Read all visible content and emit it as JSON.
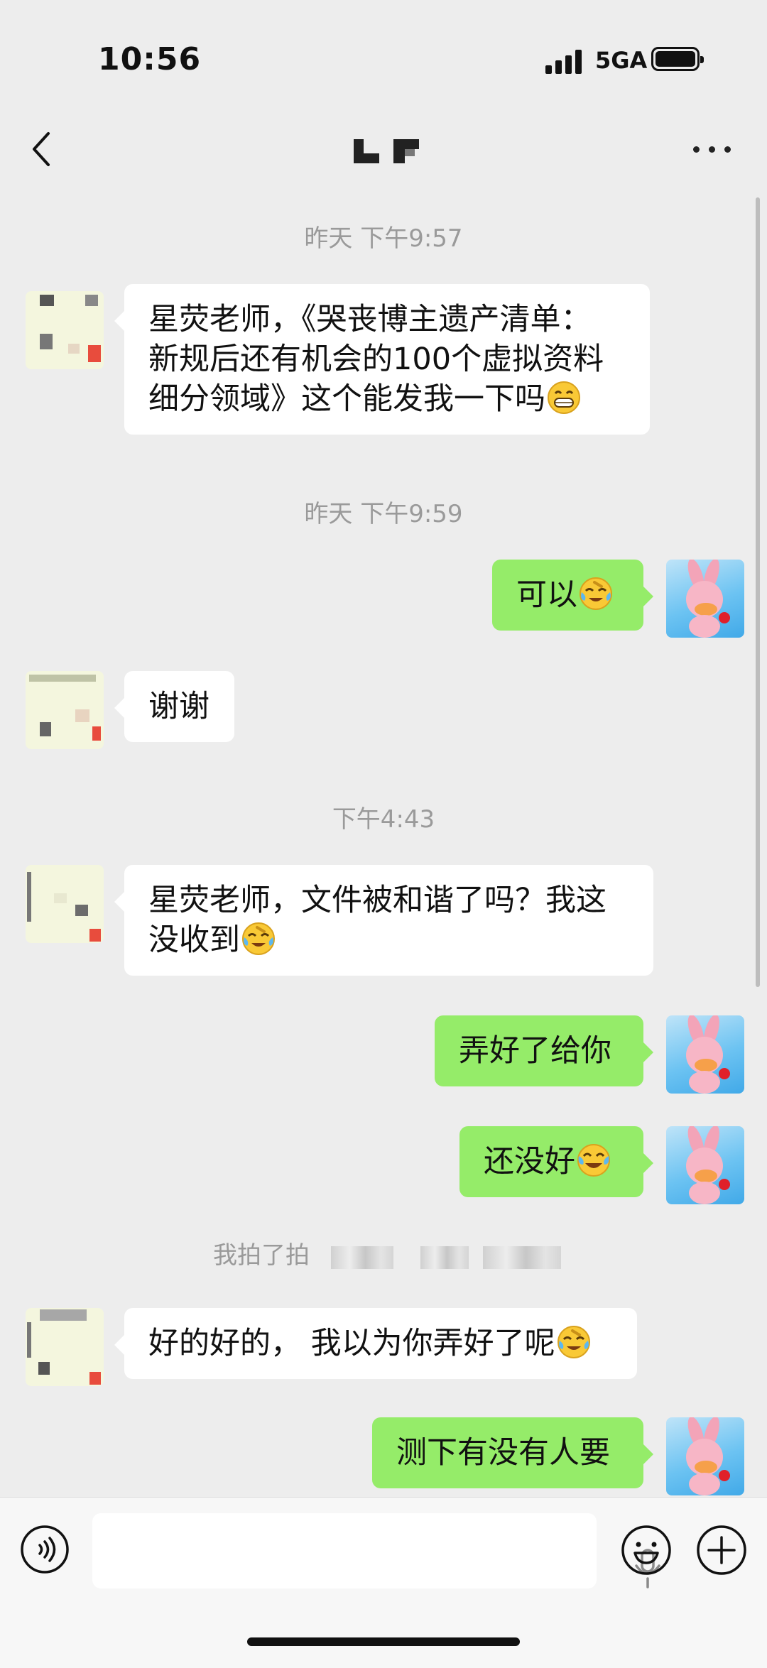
{
  "status_bar": {
    "time": "10:56",
    "network": "5GA"
  },
  "chat": {
    "timestamps": [
      "昨天 下午9:57",
      "昨天 下午9:59",
      "下午4:43"
    ],
    "system_message": "我拍了拍"
  },
  "messages": [
    {
      "side": "in",
      "lines": [
        "星荧老师，《哭丧博主遗产清单：",
        "新规后还有机会的100个虚拟资料",
        "细分领域》这个能发我一下吗"
      ],
      "emoji": "grin-emoji"
    },
    {
      "side": "out",
      "text": "可以",
      "emoji": "laugh-cry-emoji"
    },
    {
      "side": "in",
      "text": "谢谢"
    },
    {
      "side": "in",
      "lines": [
        "星荧老师，文件被和谐了吗？我这",
        "没收到"
      ],
      "emoji": "laugh-cry-emoji"
    },
    {
      "side": "out",
      "text": "弄好了给你"
    },
    {
      "side": "out",
      "text": "还没好",
      "emoji": "joy-emoji"
    },
    {
      "side": "in",
      "text": "好的好的， 我以为你弄好了呢",
      "emoji": "laugh-cry-emoji"
    },
    {
      "side": "out",
      "text": "测下有没有人要"
    }
  ]
}
